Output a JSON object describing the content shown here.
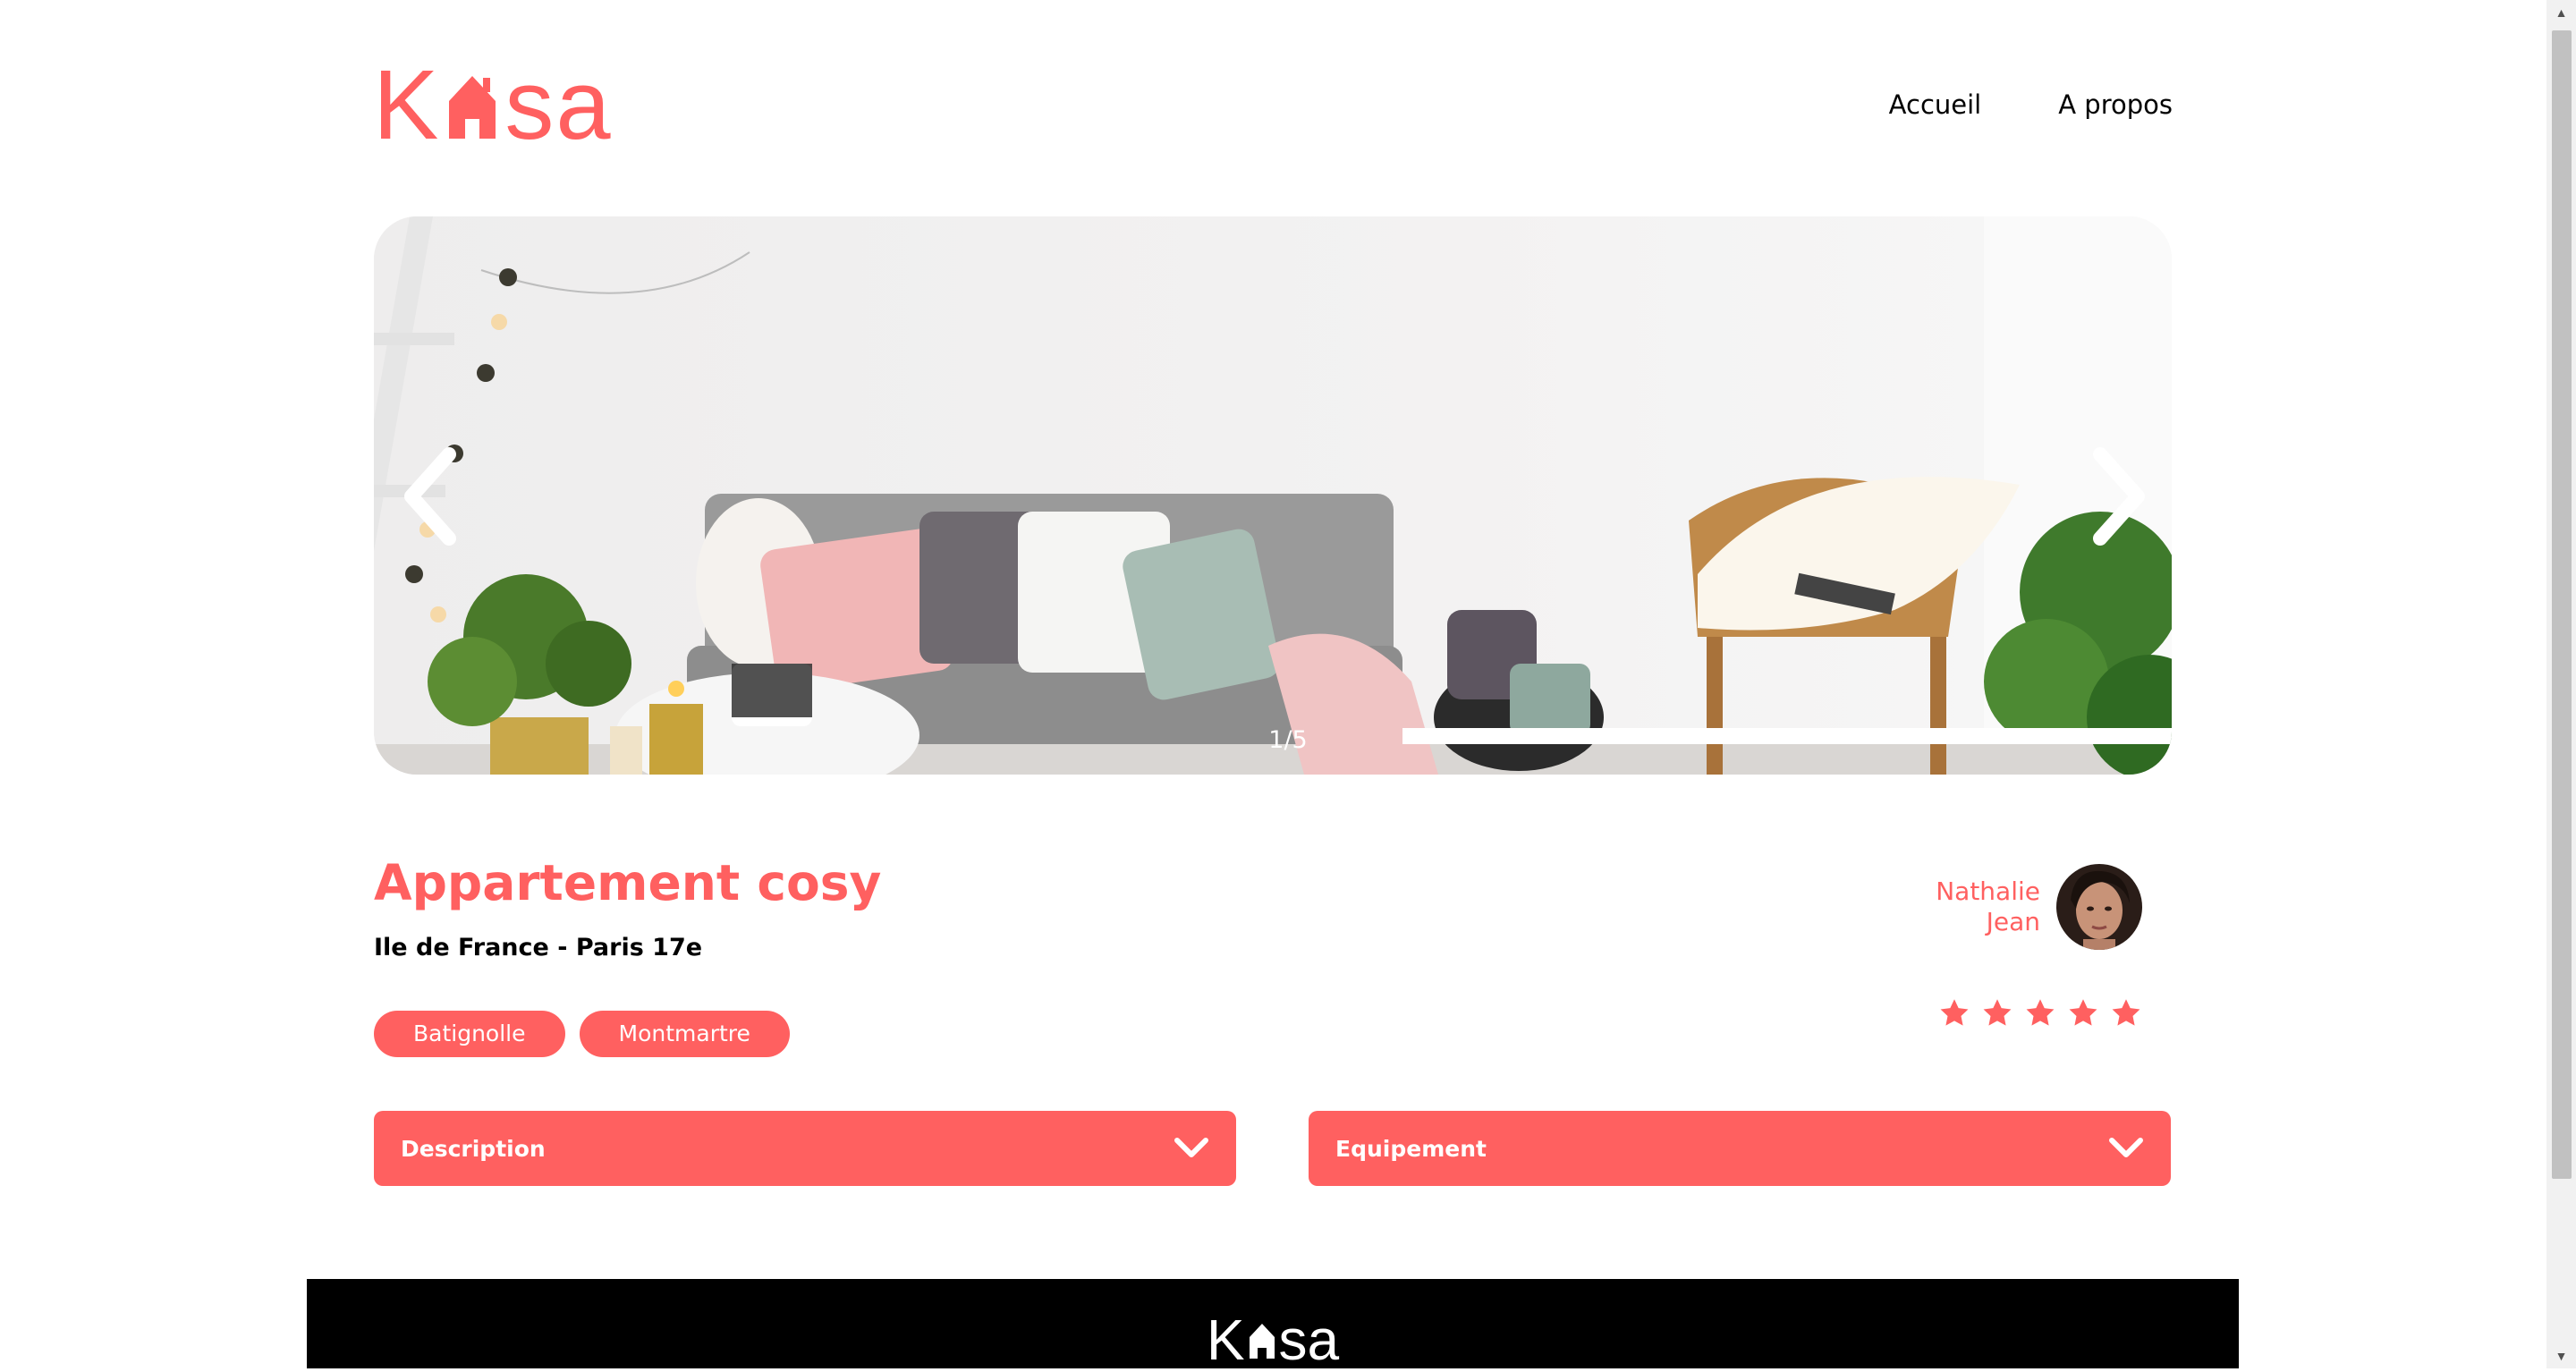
{
  "header": {
    "logo_text": "Kasa",
    "logo_letters": [
      "K",
      "sa"
    ],
    "nav": [
      {
        "label": "Accueil"
      },
      {
        "label": "A propos"
      }
    ]
  },
  "carousel": {
    "counter": "1/5",
    "current": 1,
    "total": 5,
    "prev_icon": "chevron-left-icon",
    "next_icon": "chevron-right-icon"
  },
  "listing": {
    "title": "Appartement cosy",
    "location": "Ile de France - Paris 17e",
    "tags": [
      "Batignolle",
      "Montmartre"
    ],
    "host": {
      "first_name": "Nathalie",
      "last_name": "Jean"
    },
    "rating": 5,
    "rating_max": 5
  },
  "collapses": [
    {
      "label": "Description",
      "icon": "chevron-down-icon"
    },
    {
      "label": "Equipement",
      "icon": "chevron-down-icon"
    }
  ],
  "footer": {
    "logo_letters": [
      "K",
      "sa"
    ]
  },
  "colors": {
    "accent": "#FF6060",
    "text": "#000000",
    "footer_bg": "#000000",
    "star_active": "#FF6060"
  }
}
